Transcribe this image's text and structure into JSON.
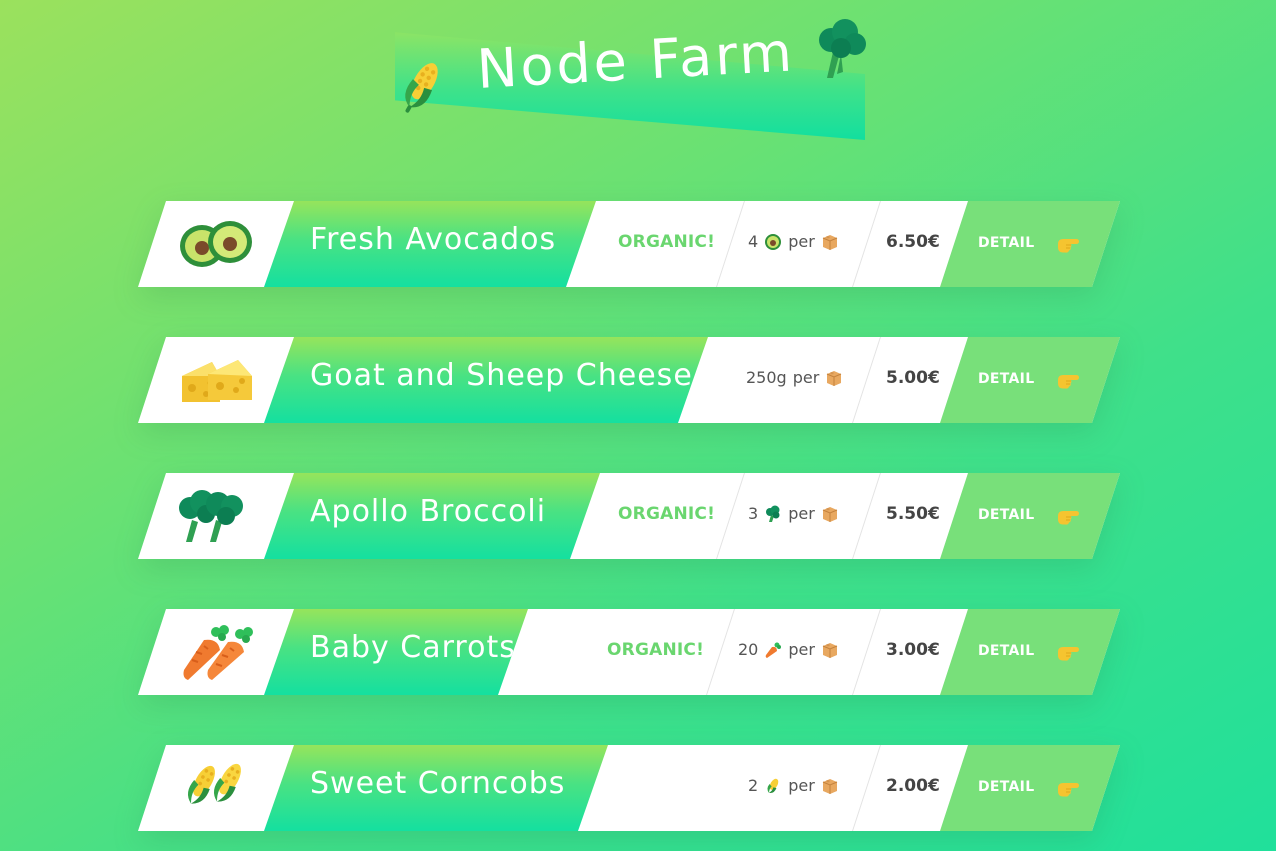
{
  "header": {
    "title": "Node Farm",
    "icon_left": "corn-icon",
    "icon_right": "broccoli-icon"
  },
  "colors": {
    "background_start": "#9be15d",
    "background_end": "#20e09b",
    "organic_text": "#6ad66f",
    "detail_button": "#78e07a"
  },
  "products": [
    {
      "name": "Fresh Avocados",
      "image": "avocado-icon",
      "organic_label": "ORGANIC!",
      "qty_amount": "4",
      "qty_unit_icon": "avocado-icon",
      "qty_per": "per",
      "qty_box_icon": "box-icon",
      "price": "6.50€",
      "detail_label": "DETAIL",
      "detail_icon": "pointing-hand-icon"
    },
    {
      "name": "Goat and Sheep Cheese",
      "image": "cheese-icon",
      "organic_label": "",
      "qty_amount": "250g",
      "qty_unit_icon": "",
      "qty_per": "per",
      "qty_box_icon": "box-icon",
      "price": "5.00€",
      "detail_label": "DETAIL",
      "detail_icon": "pointing-hand-icon"
    },
    {
      "name": "Apollo Broccoli",
      "image": "broccoli-icon",
      "organic_label": "ORGANIC!",
      "qty_amount": "3",
      "qty_unit_icon": "broccoli-icon",
      "qty_per": "per",
      "qty_box_icon": "box-icon",
      "price": "5.50€",
      "detail_label": "DETAIL",
      "detail_icon": "pointing-hand-icon"
    },
    {
      "name": "Baby Carrots",
      "image": "carrot-icon",
      "organic_label": "ORGANIC!",
      "qty_amount": "20",
      "qty_unit_icon": "carrot-icon",
      "qty_per": "per",
      "qty_box_icon": "box-icon",
      "price": "3.00€",
      "detail_label": "DETAIL",
      "detail_icon": "pointing-hand-icon"
    },
    {
      "name": "Sweet Corncobs",
      "image": "corn-icon",
      "organic_label": "",
      "qty_amount": "2",
      "qty_unit_icon": "corn-icon",
      "qty_per": "per",
      "qty_box_icon": "box-icon",
      "price": "2.00€",
      "detail_label": "DETAIL",
      "detail_icon": "pointing-hand-icon"
    }
  ]
}
